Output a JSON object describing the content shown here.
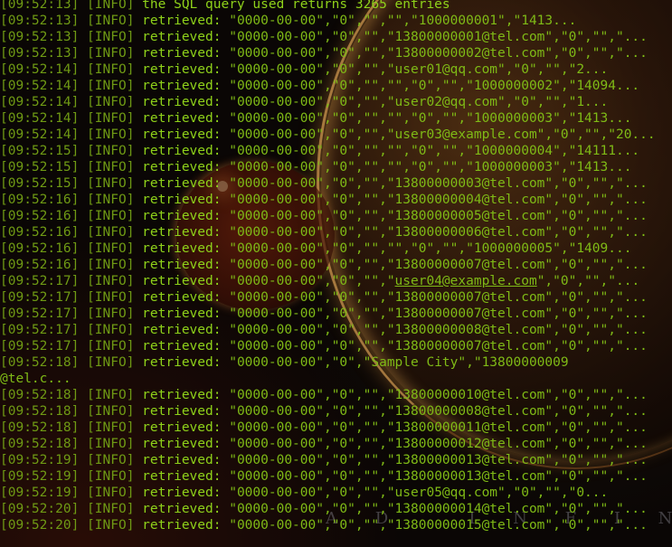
{
  "watermark": "A D . I N F I N",
  "log": [
    {
      "ts": "[09:52:13]",
      "lvl": "[INFO]",
      "msg": "the SQL query used returns 3265 entries",
      "val": ""
    },
    {
      "ts": "[09:52:13]",
      "lvl": "[INFO]",
      "msg": "retrieved:",
      "val": "\"0000-00-00\",\"0\",\"\",\"\",\"1000000001\",\"1413..."
    },
    {
      "ts": "[09:52:13]",
      "lvl": "[INFO]",
      "msg": "retrieved:",
      "val": "\"0000-00-00\",\"0\",\"\",\"13800000001@tel.com\",\"0\",\"\",\"..."
    },
    {
      "ts": "[09:52:13]",
      "lvl": "[INFO]",
      "msg": "retrieved:",
      "val": "\"0000-00-00\",\"0\",\"\",\"13800000002@tel.com\",\"0\",\"\",\"..."
    },
    {
      "ts": "[09:52:14]",
      "lvl": "[INFO]",
      "msg": "retrieved:",
      "val": "\"0000-00-00\",\"0\",\"\",\"user01@qq.com\",\"0\",\"\",\"2..."
    },
    {
      "ts": "[09:52:14]",
      "lvl": "[INFO]",
      "msg": "retrieved:",
      "val": "\"0000-00-00\",\"0\",\"\",\"\",\"0\",\"\",\"1000000002\",\"14094..."
    },
    {
      "ts": "[09:52:14]",
      "lvl": "[INFO]",
      "msg": "retrieved:",
      "val": "\"0000-00-00\",\"0\",\"\",\"user02@qq.com\",\"0\",\"\",\"1..."
    },
    {
      "ts": "[09:52:14]",
      "lvl": "[INFO]",
      "msg": "retrieved:",
      "val": "\"0000-00-00\",\"0\",\"\",\"\",\"0\",\"\",\"1000000003\",\"1413..."
    },
    {
      "ts": "[09:52:14]",
      "lvl": "[INFO]",
      "msg": "retrieved:",
      "val": "\"0000-00-00\",\"0\",\"\",\"user03@example.com\",\"0\",\"\",\"20..."
    },
    {
      "ts": "[09:52:15]",
      "lvl": "[INFO]",
      "msg": "retrieved:",
      "val": "\"0000-00-00\",\"0\",\"\",\"\",\"0\",\"\",\"1000000004\",\"14111..."
    },
    {
      "ts": "[09:52:15]",
      "lvl": "[INFO]",
      "msg": "retrieved:",
      "val": "\"0000-00-00\",\"0\",\"\",\"\",\"0\",\"\",\"1000000003\",\"1413..."
    },
    {
      "ts": "[09:52:15]",
      "lvl": "[INFO]",
      "msg": "retrieved:",
      "val": "\"0000-00-00\",\"0\",\"\",\"13800000003@tel.com\",\"0\",\"\",\"..."
    },
    {
      "ts": "[09:52:16]",
      "lvl": "[INFO]",
      "msg": "retrieved:",
      "val": "\"0000-00-00\",\"0\",\"\",\"13800000004@tel.com\",\"0\",\"\",\"..."
    },
    {
      "ts": "[09:52:16]",
      "lvl": "[INFO]",
      "msg": "retrieved:",
      "val": "\"0000-00-00\",\"0\",\"\",\"13800000005@tel.com\",\"0\",\"\",\"..."
    },
    {
      "ts": "[09:52:16]",
      "lvl": "[INFO]",
      "msg": "retrieved:",
      "val": "\"0000-00-00\",\"0\",\"\",\"13800000006@tel.com\",\"0\",\"\",\"..."
    },
    {
      "ts": "[09:52:16]",
      "lvl": "[INFO]",
      "msg": "retrieved:",
      "val": "\"0000-00-00\",\"0\",\"\",\"\",\"0\",\"\",\"1000000005\",\"1409..."
    },
    {
      "ts": "[09:52:16]",
      "lvl": "[INFO]",
      "msg": "retrieved:",
      "val": "\"0000-00-00\",\"0\",\"\",\"13800000007@tel.com\",\"0\",\"\",\"..."
    },
    {
      "ts": "[09:52:17]",
      "lvl": "[INFO]",
      "msg": "retrieved:",
      "val": "\"0000-00-00\",\"0\",\"\",\"",
      "link": "user04@example.com",
      "tail": "\",\"0\",\"\",\"..."
    },
    {
      "ts": "[09:52:17]",
      "lvl": "[INFO]",
      "msg": "retrieved:",
      "val": "\"0000-00-00\",\"0\",\"\",\"13800000007@tel.com\",\"0\",\"\",\"..."
    },
    {
      "ts": "[09:52:17]",
      "lvl": "[INFO]",
      "msg": "retrieved:",
      "val": "\"0000-00-00\",\"0\",\"\",\"13800000007@tel.com\",\"0\",\"\",\"..."
    },
    {
      "ts": "[09:52:17]",
      "lvl": "[INFO]",
      "msg": "retrieved:",
      "val": "\"0000-00-00\",\"0\",\"\",\"13800000008@tel.com\",\"0\",\"\",\"..."
    },
    {
      "ts": "[09:52:17]",
      "lvl": "[INFO]",
      "msg": "retrieved:",
      "val": "\"0000-00-00\",\"0\",\"\",\"13800000007@tel.com\",\"0\",\"\",\"..."
    },
    {
      "ts": "[09:52:18]",
      "lvl": "[INFO]",
      "msg": "retrieved:",
      "val": "\"0000-00-00\",\"0\",\"Sample City\",\"13800000009"
    },
    {
      "ts": "",
      "lvl": "",
      "msg": "",
      "val": "@tel.c..."
    },
    {
      "ts": "[09:52:18]",
      "lvl": "[INFO]",
      "msg": "retrieved:",
      "val": "\"0000-00-00\",\"0\",\"\",\"13800000010@tel.com\",\"0\",\"\",\"..."
    },
    {
      "ts": "[09:52:18]",
      "lvl": "[INFO]",
      "msg": "retrieved:",
      "val": "\"0000-00-00\",\"0\",\"\",\"13800000008@tel.com\",\"0\",\"\",\"..."
    },
    {
      "ts": "[09:52:18]",
      "lvl": "[INFO]",
      "msg": "retrieved:",
      "val": "\"0000-00-00\",\"0\",\"\",\"13800000011@tel.com\",\"0\",\"\",\"..."
    },
    {
      "ts": "[09:52:18]",
      "lvl": "[INFO]",
      "msg": "retrieved:",
      "val": "\"0000-00-00\",\"0\",\"\",\"13800000012@tel.com\",\"0\",\"\",\"..."
    },
    {
      "ts": "[09:52:19]",
      "lvl": "[INFO]",
      "msg": "retrieved:",
      "val": "\"0000-00-00\",\"0\",\"\",\"13800000013@tel.com\",\"0\",\"\",\"..."
    },
    {
      "ts": "[09:52:19]",
      "lvl": "[INFO]",
      "msg": "retrieved:",
      "val": "\"0000-00-00\",\"0\",\"\",\"13800000013@tel.com\",\"0\",\"\",\"..."
    },
    {
      "ts": "[09:52:19]",
      "lvl": "[INFO]",
      "msg": "retrieved:",
      "val": "\"0000-00-00\",\"0\",\"\",\"user05@qq.com\",\"0\",\"\",\"0..."
    },
    {
      "ts": "[09:52:20]",
      "lvl": "[INFO]",
      "msg": "retrieved:",
      "val": "\"0000-00-00\",\"0\",\"\",\"13800000014@tel.com\",\"0\",\"\",\"..."
    },
    {
      "ts": "[09:52:20]",
      "lvl": "[INFO]",
      "msg": "retrieved:",
      "val": "\"0000-00-00\",\"0\",\"\",\"13800000015@tel.com\",\"0\",\"\",\"..."
    }
  ]
}
